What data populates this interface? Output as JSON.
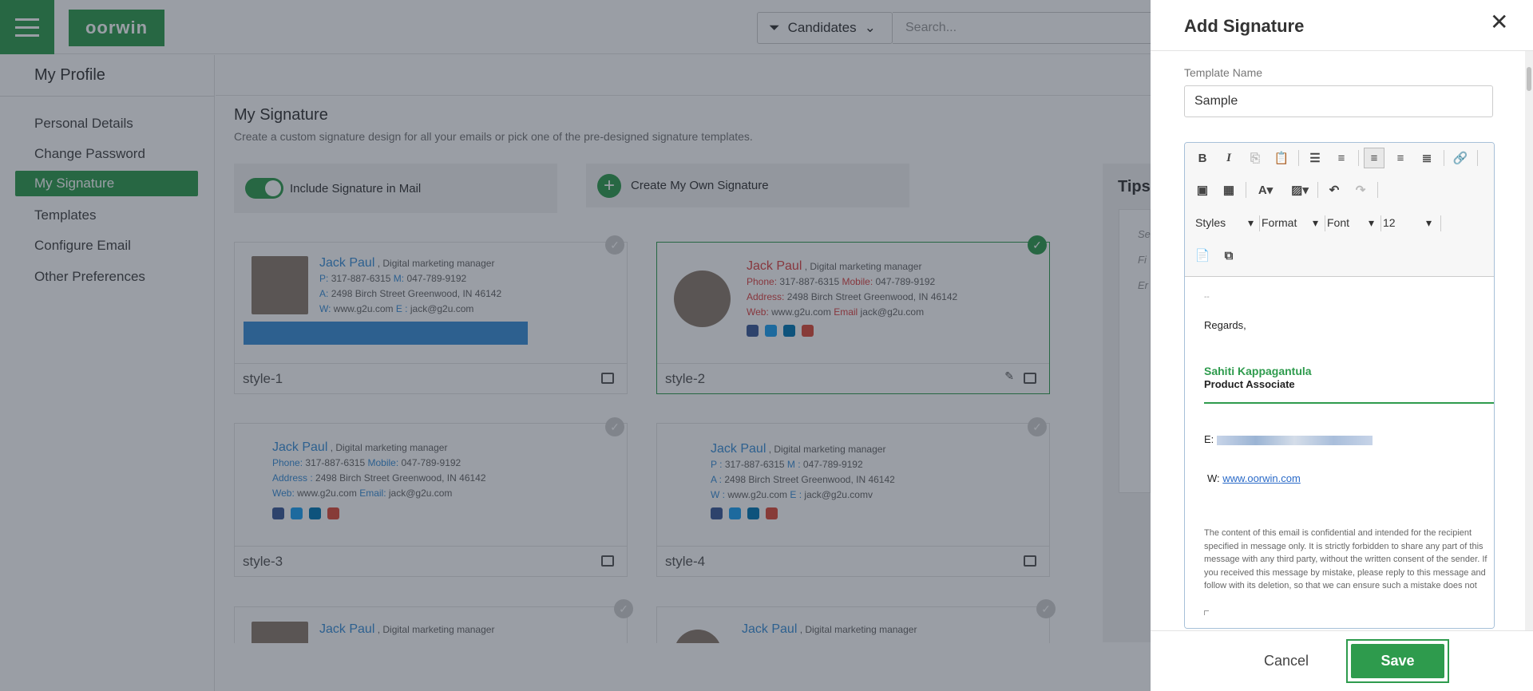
{
  "app": {
    "logo": "oorwin"
  },
  "topbar": {
    "filter_label": "Candidates",
    "search_placeholder": "Search..."
  },
  "sidebar": {
    "title": "My Profile",
    "items": [
      {
        "label": "Personal Details"
      },
      {
        "label": "Change Password"
      },
      {
        "label": "My Signature"
      },
      {
        "label": "Templates"
      },
      {
        "label": "Configure Email"
      },
      {
        "label": "Other Preferences"
      }
    ]
  },
  "main": {
    "title": "My Signature",
    "subtitle": "Create a custom signature design for all your emails or pick one of the pre-designed signature templates.",
    "include_label": "Include Signature in Mail",
    "create_label": "Create My Own Signature",
    "tips_title": "Tips",
    "tips_lines": [
      "Se",
      "Fi",
      "Er"
    ]
  },
  "signature": {
    "name": "Jack Paul",
    "role": ", Digital marketing manager",
    "phone": "317-887-6315",
    "mobile": "047-789-9192",
    "address": "2498 Birch Street Greenwood, IN 46142",
    "web": "www.g2u.com",
    "email": "jack@g2u.com",
    "email_alt": "jack@g2u.comv",
    "label_p": "P:",
    "label_m": "M:",
    "label_a": "A:",
    "label_w": "W:",
    "label_e": "E :",
    "label_phone": "Phone:",
    "label_mobile": "Mobile:",
    "label_address": "Address:",
    "label_address_sp": "Address :",
    "label_web": "Web:",
    "label_email": "Email",
    "label_email_colon": "Email:",
    "label_p_sp": "P :",
    "label_m_sp": "M :",
    "label_a_sp": "A :",
    "label_w_sp": "W :",
    "label_e_sp": "E :"
  },
  "cards": [
    {
      "label": "style-1"
    },
    {
      "label": "style-2"
    },
    {
      "label": "style-3"
    },
    {
      "label": "style-4"
    }
  ],
  "panel": {
    "title": "Add Signature",
    "template_name_label": "Template Name",
    "template_name_value": "Sample",
    "toolbar": {
      "styles": "Styles",
      "format": "Format",
      "font": "Font",
      "size": "12"
    },
    "editor": {
      "dashes": "--",
      "regards": "Regards,",
      "name": "Sahiti Kappagantula",
      "role": "Product Associate",
      "email_label": "E:",
      "web_label": "W:",
      "web": "www.oorwin.com",
      "disclaimer": "The content of this email is confidential and intended for the recipient specified in message only. It is strictly forbidden to share any part of this message with any third party, without the written consent of the sender. If you received this message by mistake, please reply to this message and follow with its deletion, so that we can ensure such a mistake does not occur in the future."
    },
    "cancel_label": "Cancel",
    "save_label": "Save"
  },
  "colors": {
    "brand": "#2e9b4d",
    "link_blue": "#3a8fd8",
    "accent_red": "#dd4444"
  }
}
